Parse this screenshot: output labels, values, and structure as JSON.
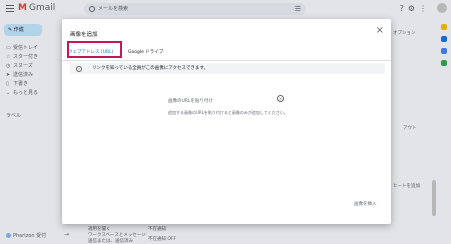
{
  "app": {
    "name": "Gmail",
    "search_placeholder": "メールを検索"
  },
  "sidebar": {
    "compose_label": "作成",
    "items": [
      {
        "label": "受信トレイ"
      },
      {
        "label": "スター付き"
      },
      {
        "label": "スヌーズ"
      },
      {
        "label": "送信済み"
      },
      {
        "label": "下書き"
      },
      {
        "label": "もっと見る"
      }
    ],
    "labels_heading": "ラベル"
  },
  "background": {
    "right_text_1": "オプション",
    "right_text_2": "アウト",
    "right_text_3": "ヒートを追加",
    "meet_label": "Pharizon 受付",
    "footer_1": "適用を聞く",
    "footer_2": "ワークスペースとメッセージ",
    "footer_3": "送信または、送信済み",
    "footer_4": "不在通知",
    "footer_5": "不在通知 OFF"
  },
  "dialog": {
    "title": "画像を追加",
    "close_icon": "close-icon",
    "tabs": [
      {
        "label": "ウェブアドレス (URL)",
        "active": true
      },
      {
        "label": "Google ドライブ",
        "active": false
      }
    ],
    "info_text": "リンクを知っている全員がこの画像にアクセスできます。",
    "url_label": "画像のURLを貼り付け",
    "url_hint": "追加する画像のURLを貼り付けると画像のみが追加してください。",
    "insert_label": "画像を挿入"
  },
  "colors": {
    "highlight": "#c2185b",
    "accent": "#1a73e8",
    "gmail_red": "#ea4335"
  }
}
